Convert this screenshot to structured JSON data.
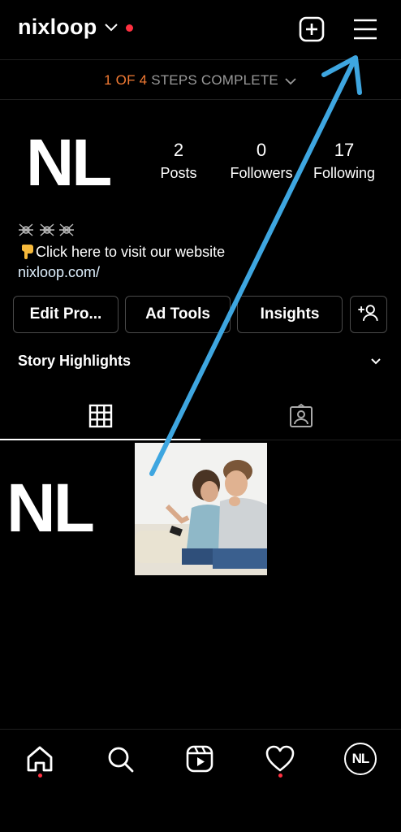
{
  "header": {
    "username": "nixloop",
    "notification_color": "#ff3040"
  },
  "setup": {
    "progress": "1 OF 4",
    "label": "STEPS COMPLETE",
    "accent": "#f27a33"
  },
  "profile": {
    "avatar_text": "NL",
    "stats": [
      {
        "value": "2",
        "label": "Posts"
      },
      {
        "value": "0",
        "label": "Followers"
      },
      {
        "value": "17",
        "label": "Following"
      }
    ],
    "bio_text": "Click here to visit our website",
    "bio_link": "nixloop.com/"
  },
  "buttons": {
    "edit": "Edit Pro...",
    "ad_tools": "Ad Tools",
    "insights": "Insights"
  },
  "highlights": {
    "label": "Story Highlights"
  },
  "grid": {
    "post1_text": "NL"
  },
  "nav": {
    "avatar_text": "NL"
  },
  "annotation": {
    "arrow_color": "#3ea6e0"
  }
}
